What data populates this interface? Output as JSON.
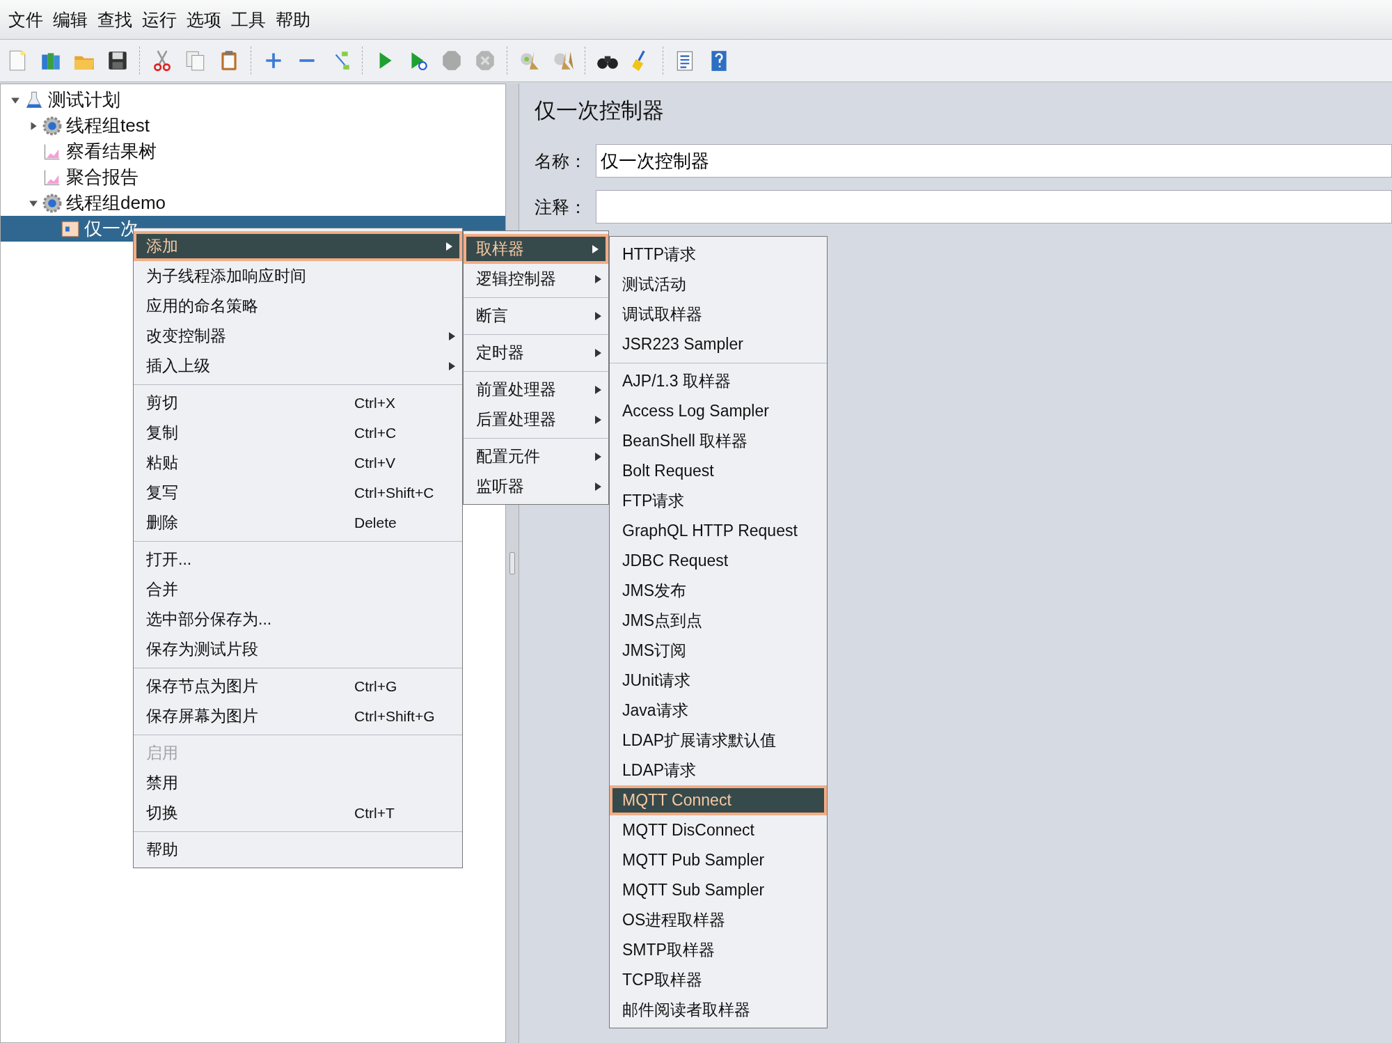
{
  "menu_bar": [
    "文件",
    "编辑",
    "查找",
    "运行",
    "选项",
    "工具",
    "帮助"
  ],
  "tree": [
    {
      "label": "测试计划",
      "kind": "plan",
      "expanded": true,
      "selected": false,
      "children": [
        {
          "label": "线程组test",
          "kind": "threads",
          "expanded": false,
          "selected": false
        },
        {
          "label": "察看结果树",
          "kind": "listener",
          "selected": false
        },
        {
          "label": "聚合报告",
          "kind": "listener",
          "selected": false
        },
        {
          "label": "线程组demo",
          "kind": "threads",
          "expanded": true,
          "selected": false,
          "children": [
            {
              "label": "仅一次",
              "kind": "controller",
              "selected": true
            }
          ]
        }
      ]
    }
  ],
  "panel": {
    "title": "仅一次控制器",
    "fields": [
      {
        "label": "名称：",
        "value": "仅一次控制器"
      },
      {
        "label": "注释："
      }
    ]
  },
  "menus": [
    {
      "items": [
        {
          "kind": "item",
          "label": "添加",
          "submenu": true,
          "selected": true,
          "disabled": false
        },
        {
          "kind": "item",
          "label": "为子线程添加响应时间",
          "submenu": false,
          "selected": false,
          "disabled": false
        },
        {
          "kind": "item",
          "label": "应用的命名策略",
          "submenu": false,
          "selected": false,
          "disabled": false
        },
        {
          "kind": "item",
          "label": "改变控制器",
          "submenu": true,
          "selected": false,
          "disabled": false
        },
        {
          "kind": "item",
          "label": "插入上级",
          "submenu": true,
          "selected": false,
          "disabled": false
        },
        {
          "kind": "separator"
        },
        {
          "kind": "item",
          "label": "剪切",
          "shortcut": "Ctrl+X",
          "submenu": false,
          "selected": false,
          "disabled": false
        },
        {
          "kind": "item",
          "label": "复制",
          "shortcut": "Ctrl+C",
          "submenu": false,
          "selected": false,
          "disabled": false
        },
        {
          "kind": "item",
          "label": "粘贴",
          "shortcut": "Ctrl+V",
          "submenu": false,
          "selected": false,
          "disabled": false
        },
        {
          "kind": "item",
          "label": "复写",
          "shortcut": "Ctrl+Shift+C",
          "submenu": false,
          "selected": false,
          "disabled": false
        },
        {
          "kind": "item",
          "label": "删除",
          "shortcut": "Delete",
          "submenu": false,
          "selected": false,
          "disabled": false
        },
        {
          "kind": "separator"
        },
        {
          "kind": "item",
          "label": "打开...",
          "submenu": false,
          "selected": false,
          "disabled": false
        },
        {
          "kind": "item",
          "label": "合并",
          "submenu": false,
          "selected": false,
          "disabled": false
        },
        {
          "kind": "item",
          "label": "选中部分保存为...",
          "submenu": false,
          "selected": false,
          "disabled": false
        },
        {
          "kind": "item",
          "label": "保存为测试片段",
          "submenu": false,
          "selected": false,
          "disabled": false
        },
        {
          "kind": "separator"
        },
        {
          "kind": "item",
          "label": "保存节点为图片",
          "shortcut": "Ctrl+G",
          "submenu": false,
          "selected": false,
          "disabled": false
        },
        {
          "kind": "item",
          "label": "保存屏幕为图片",
          "shortcut": "Ctrl+Shift+G",
          "submenu": false,
          "selected": false,
          "disabled": false
        },
        {
          "kind": "separator"
        },
        {
          "kind": "item",
          "label": "启用",
          "submenu": false,
          "selected": false,
          "disabled": true
        },
        {
          "kind": "item",
          "label": "禁用",
          "submenu": false,
          "selected": false,
          "disabled": false
        },
        {
          "kind": "item",
          "label": "切换",
          "shortcut": "Ctrl+T",
          "submenu": false,
          "selected": false,
          "disabled": false
        },
        {
          "kind": "separator"
        },
        {
          "kind": "item",
          "label": "帮助",
          "submenu": false,
          "selected": false,
          "disabled": false
        }
      ]
    },
    {
      "items": [
        {
          "kind": "item",
          "label": "取样器",
          "submenu": true,
          "selected": true,
          "disabled": false
        },
        {
          "kind": "item",
          "label": "逻辑控制器",
          "submenu": true,
          "selected": false,
          "disabled": false
        },
        {
          "kind": "separator"
        },
        {
          "kind": "item",
          "label": "断言",
          "submenu": true,
          "selected": false,
          "disabled": false
        },
        {
          "kind": "separator"
        },
        {
          "kind": "item",
          "label": "定时器",
          "submenu": true,
          "selected": false,
          "disabled": false
        },
        {
          "kind": "separator"
        },
        {
          "kind": "item",
          "label": "前置处理器",
          "submenu": true,
          "selected": false,
          "disabled": false
        },
        {
          "kind": "item",
          "label": "后置处理器",
          "submenu": true,
          "selected": false,
          "disabled": false
        },
        {
          "kind": "separator"
        },
        {
          "kind": "item",
          "label": "配置元件",
          "submenu": true,
          "selected": false,
          "disabled": false
        },
        {
          "kind": "item",
          "label": "监听器",
          "submenu": true,
          "selected": false,
          "disabled": false
        }
      ]
    },
    {
      "items": [
        {
          "kind": "item",
          "label": "HTTP请求",
          "submenu": false,
          "selected": false,
          "disabled": false
        },
        {
          "kind": "item",
          "label": "测试活动",
          "submenu": false,
          "selected": false,
          "disabled": false
        },
        {
          "kind": "item",
          "label": "调试取样器",
          "submenu": false,
          "selected": false,
          "disabled": false
        },
        {
          "kind": "item",
          "label": "JSR223 Sampler",
          "submenu": false,
          "selected": false,
          "disabled": false
        },
        {
          "kind": "separator"
        },
        {
          "kind": "item",
          "label": "AJP/1.3 取样器",
          "submenu": false,
          "selected": false,
          "disabled": false
        },
        {
          "kind": "item",
          "label": "Access Log Sampler",
          "submenu": false,
          "selected": false,
          "disabled": false
        },
        {
          "kind": "item",
          "label": "BeanShell 取样器",
          "submenu": false,
          "selected": false,
          "disabled": false
        },
        {
          "kind": "item",
          "label": "Bolt Request",
          "submenu": false,
          "selected": false,
          "disabled": false
        },
        {
          "kind": "item",
          "label": "FTP请求",
          "submenu": false,
          "selected": false,
          "disabled": false
        },
        {
          "kind": "item",
          "label": "GraphQL HTTP Request",
          "submenu": false,
          "selected": false,
          "disabled": false
        },
        {
          "kind": "item",
          "label": "JDBC Request",
          "submenu": false,
          "selected": false,
          "disabled": false
        },
        {
          "kind": "item",
          "label": "JMS发布",
          "submenu": false,
          "selected": false,
          "disabled": false
        },
        {
          "kind": "item",
          "label": "JMS点到点",
          "submenu": false,
          "selected": false,
          "disabled": false
        },
        {
          "kind": "item",
          "label": "JMS订阅",
          "submenu": false,
          "selected": false,
          "disabled": false
        },
        {
          "kind": "item",
          "label": "JUnit请求",
          "submenu": false,
          "selected": false,
          "disabled": false
        },
        {
          "kind": "item",
          "label": "Java请求",
          "submenu": false,
          "selected": false,
          "disabled": false
        },
        {
          "kind": "item",
          "label": "LDAP扩展请求默认值",
          "submenu": false,
          "selected": false,
          "disabled": false
        },
        {
          "kind": "item",
          "label": "LDAP请求",
          "submenu": false,
          "selected": false,
          "disabled": false
        },
        {
          "kind": "item",
          "label": "MQTT Connect",
          "submenu": false,
          "selected": true,
          "disabled": false
        },
        {
          "kind": "item",
          "label": "MQTT DisConnect",
          "submenu": false,
          "selected": false,
          "disabled": false
        },
        {
          "kind": "item",
          "label": "MQTT Pub Sampler",
          "submenu": false,
          "selected": false,
          "disabled": false
        },
        {
          "kind": "item",
          "label": "MQTT Sub Sampler",
          "submenu": false,
          "selected": false,
          "disabled": false
        },
        {
          "kind": "item",
          "label": "OS进程取样器",
          "submenu": false,
          "selected": false,
          "disabled": false
        },
        {
          "kind": "item",
          "label": "SMTP取样器",
          "submenu": false,
          "selected": false,
          "disabled": false
        },
        {
          "kind": "item",
          "label": "TCP取样器",
          "submenu": false,
          "selected": false,
          "disabled": false
        },
        {
          "kind": "item",
          "label": "邮件阅读者取样器",
          "submenu": false,
          "selected": false,
          "disabled": false
        }
      ]
    }
  ]
}
